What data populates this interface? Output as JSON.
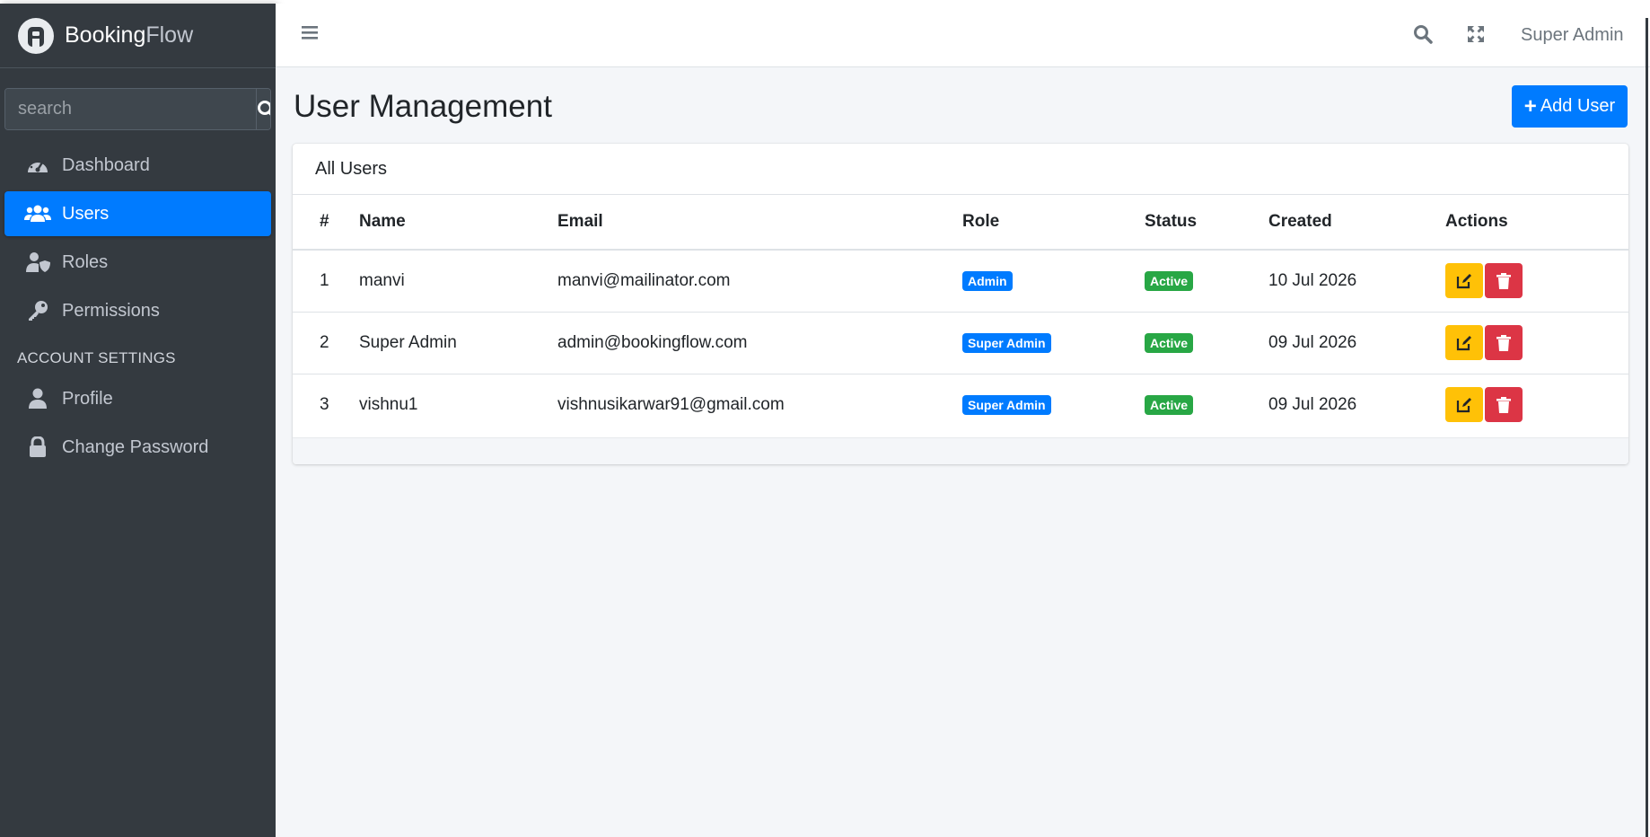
{
  "brand": {
    "part1": "Booking",
    "part2": "Flow"
  },
  "sidebar": {
    "search_placeholder": "search",
    "items": [
      {
        "label": "Dashboard",
        "icon": "dashboard-gauge-icon",
        "active": false
      },
      {
        "label": "Users",
        "icon": "users-icon",
        "active": true
      },
      {
        "label": "Roles",
        "icon": "user-shield-icon",
        "active": false
      },
      {
        "label": "Permissions",
        "icon": "key-icon",
        "active": false
      }
    ],
    "section_header": "ACCOUNT SETTINGS",
    "account_items": [
      {
        "label": "Profile",
        "icon": "user-icon"
      },
      {
        "label": "Change Password",
        "icon": "lock-icon"
      }
    ]
  },
  "topbar": {
    "user_name": "Super Admin"
  },
  "page": {
    "title": "User Management",
    "add_button": "Add User"
  },
  "card": {
    "title": "All Users"
  },
  "table": {
    "headers": [
      "#",
      "Name",
      "Email",
      "Role",
      "Status",
      "Created",
      "Actions"
    ],
    "rows": [
      {
        "num": "1",
        "name": "manvi",
        "email": "manvi@mailinator.com",
        "role": "Admin",
        "status": "Active",
        "created": "10 Jul 2026"
      },
      {
        "num": "2",
        "name": "Super Admin",
        "email": "admin@bookingflow.com",
        "role": "Super Admin",
        "status": "Active",
        "created": "09 Jul 2026"
      },
      {
        "num": "3",
        "name": "vishnu1",
        "email": "vishnusikarwar91@gmail.com",
        "role": "Super Admin",
        "status": "Active",
        "created": "09 Jul 2026"
      }
    ]
  },
  "colors": {
    "sidebar_bg": "#343a40",
    "primary": "#007bff",
    "success": "#28a745",
    "warning": "#ffc107",
    "danger": "#dc3545",
    "content_bg": "#f4f6f9"
  }
}
